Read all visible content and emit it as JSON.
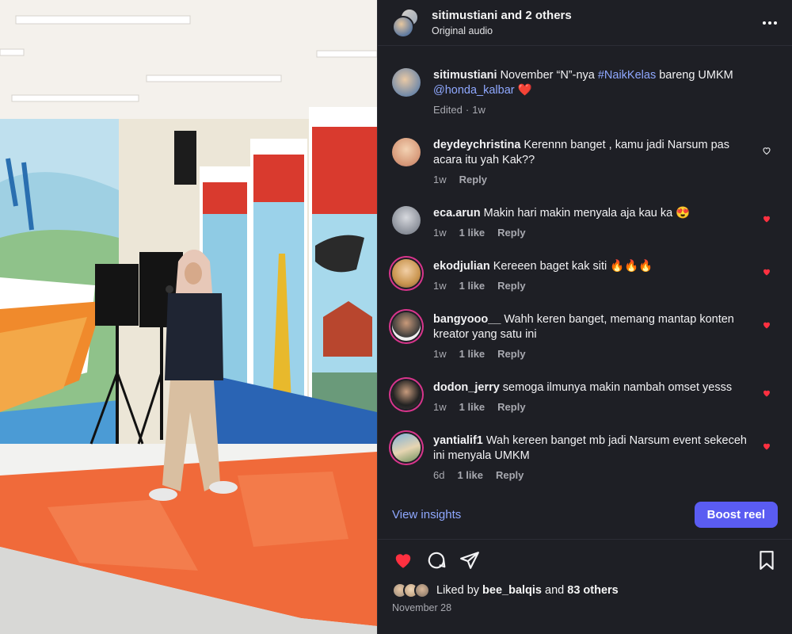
{
  "header": {
    "username": "sitimustiani",
    "coauthors": "and 2 others",
    "subtitle": "Original audio",
    "more_icon": "more-horizontal-icon"
  },
  "caption": {
    "username": "sitimustiani",
    "text_before": "November “N”-nya ",
    "hashtag": "#NaikKelas",
    "text_mid": " bareng UMKM",
    "mention": "@honda_kalbar",
    "emoji": "❤️",
    "edited": "Edited",
    "time": "1w"
  },
  "comments": [
    {
      "username": "deydeychristina",
      "text": "Kerennn banget , kamu jadi Narsum pas acara itu yah Kak??",
      "time": "1w",
      "likes": "",
      "reply": "Reply",
      "liked": false
    },
    {
      "username": "eca.arun",
      "text": "Makin hari makin menyala aja kau ka 😍",
      "time": "1w",
      "likes": "1 like",
      "reply": "Reply",
      "liked": true
    },
    {
      "username": "ekodjulian",
      "text": "Kereeen baget kak siti 🔥🔥🔥",
      "time": "1w",
      "likes": "1 like",
      "reply": "Reply",
      "liked": true
    },
    {
      "username": "bangyooo__",
      "text": "Wahh keren banget, memang mantap konten kreator yang satu ini",
      "time": "1w",
      "likes": "1 like",
      "reply": "Reply",
      "liked": true
    },
    {
      "username": "dodon_jerry",
      "text": "semoga ilmunya makin nambah omset yesss",
      "time": "1w",
      "likes": "1 like",
      "reply": "Reply",
      "liked": true
    },
    {
      "username": "yantialif1",
      "text": "Wah kereen banget mb jadi Narsum event sekeceh ini menyala UMKM",
      "time": "6d",
      "likes": "1 like",
      "reply": "Reply",
      "liked": true
    }
  ],
  "actions": {
    "view_insights": "View insights",
    "boost": "Boost reel"
  },
  "likes": {
    "prefix": "Liked by",
    "user": "bee_balqis",
    "and": "and",
    "others": "83 others",
    "date": "November 28"
  },
  "colors": {
    "accent_link": "#8fa8ff",
    "boost_button": "#5a5cf2",
    "like_red": "#ff3040",
    "story_ring": "#d8358c"
  }
}
